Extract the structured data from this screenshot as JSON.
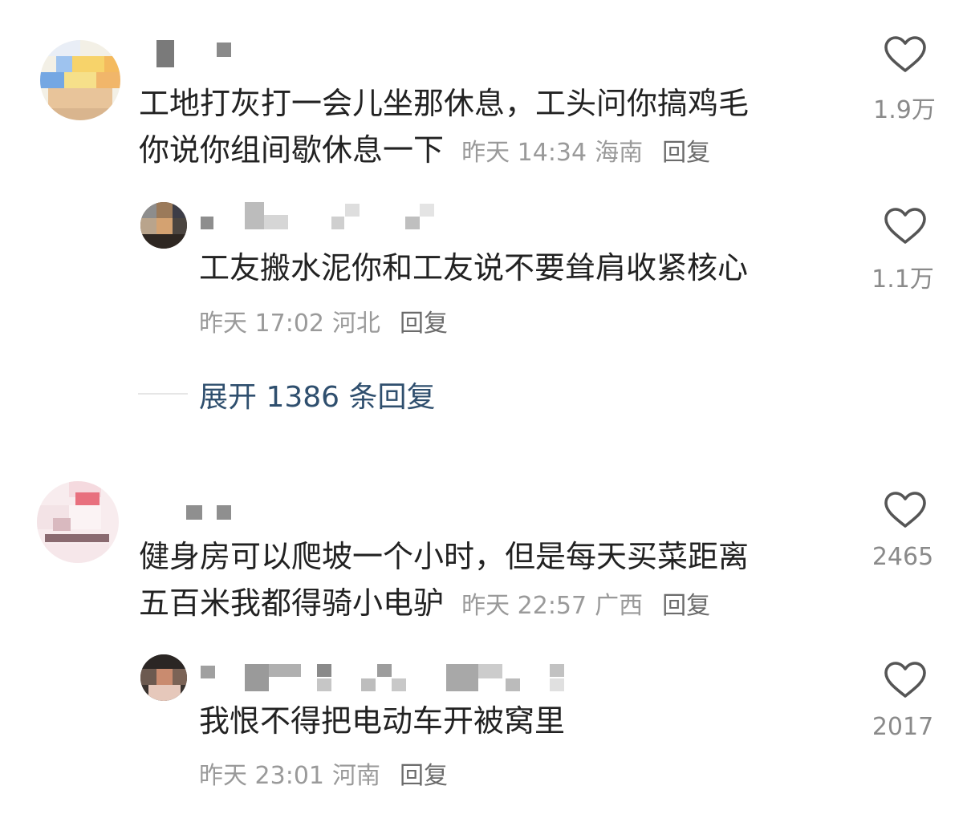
{
  "comments": [
    {
      "text_line1": "工地打灰打一会儿坐那休息，工头问你搞鸡毛",
      "text_line2": "你说你组间歇休息一下",
      "time": "昨天 14:34",
      "location": "海南",
      "reply_label": "回复",
      "likes": "1.9万",
      "reply": {
        "text": "工友搬水泥你和工友说不要耸肩收紧核心",
        "time": "昨天 17:02",
        "location": "河北",
        "reply_label": "回复",
        "likes": "1.1万"
      },
      "expand_label": "展开 1386 条回复"
    },
    {
      "text_line1": "健身房可以爬坡一个小时，但是每天买菜距离",
      "text_line2": "五百米我都得骑小电驴",
      "time": "昨天 22:57",
      "location": "广西",
      "reply_label": "回复",
      "likes": "2465",
      "reply": {
        "text": "我恨不得把电动车开被窝里",
        "time": "昨天 23:01",
        "location": "河南",
        "reply_label": "回复",
        "likes": "2017"
      }
    }
  ],
  "icons": {
    "like": "heart-outline-icon"
  },
  "colors": {
    "meta": "#9a9a9a",
    "expand": "#2f4f6e"
  }
}
